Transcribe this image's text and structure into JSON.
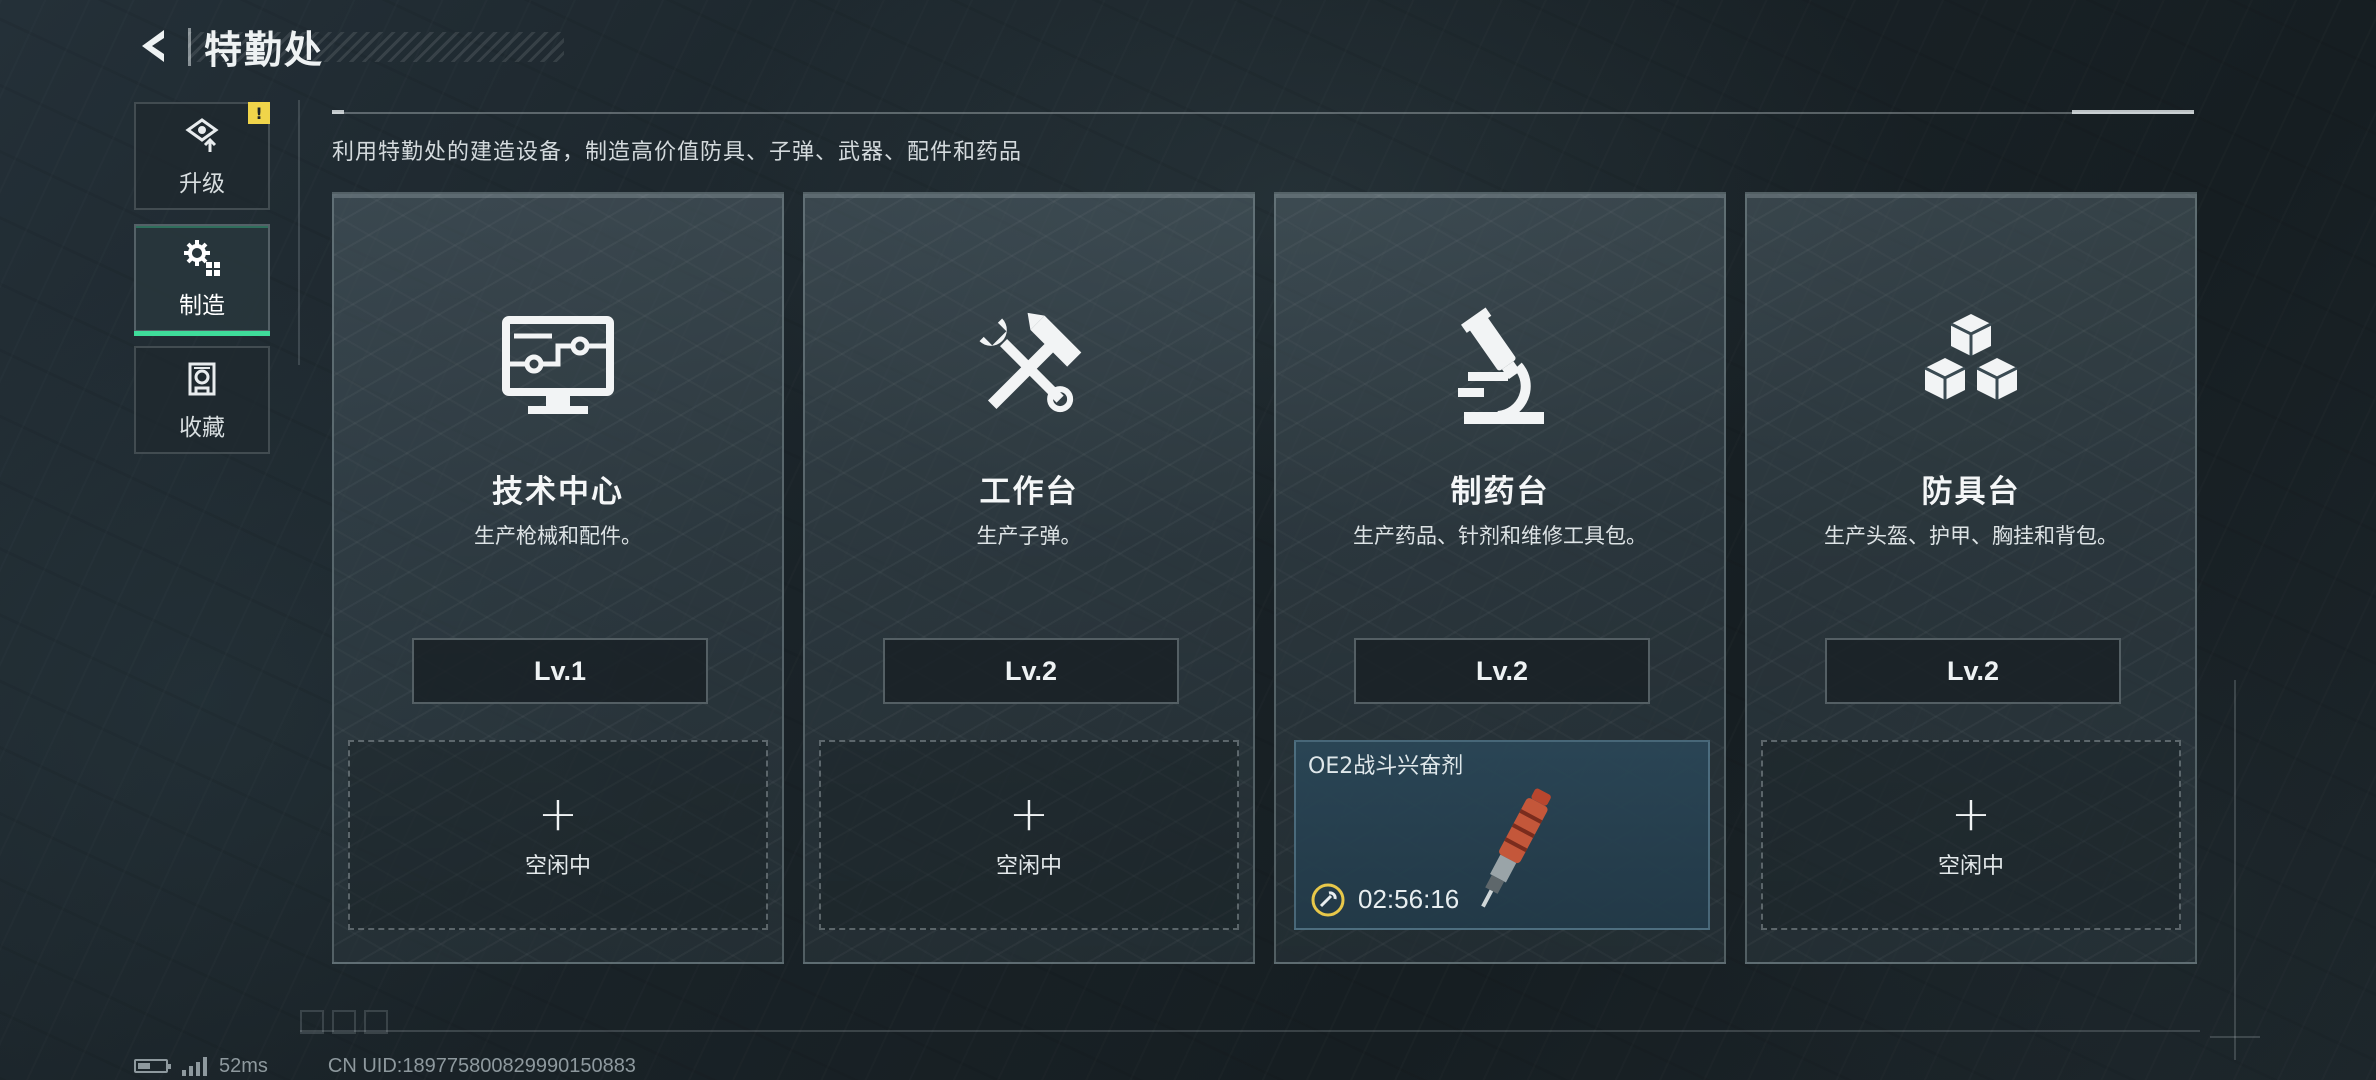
{
  "header": {
    "title": "特勤处"
  },
  "nav": {
    "items": [
      {
        "label": "升级",
        "icon": "upgrade-icon",
        "alert": "!"
      },
      {
        "label": "制造",
        "icon": "gear-grid-icon",
        "active": true
      },
      {
        "label": "收藏",
        "icon": "collection-icon"
      }
    ]
  },
  "description": "利用特勤处的建造设备，制造高价值防具、子弹、武器、配件和药品",
  "stations": [
    {
      "title": "技术中心",
      "subtitle": "生产枪械和配件。",
      "level": "Lv.1",
      "slot": {
        "status": "idle",
        "plus": "+",
        "label": "空闲中"
      },
      "icon": "computer-icon"
    },
    {
      "title": "工作台",
      "subtitle": "生产子弹。",
      "level": "Lv.2",
      "slot": {
        "status": "idle",
        "plus": "+",
        "label": "空闲中"
      },
      "icon": "hammer-wrench-icon"
    },
    {
      "title": "制药台",
      "subtitle": "生产药品、针剂和维修工具包。",
      "level": "Lv.2",
      "slot": {
        "status": "crafting",
        "item_name": "OE2战斗兴奋剂",
        "timer": "02:56:16"
      },
      "icon": "microscope-icon"
    },
    {
      "title": "防具台",
      "subtitle": "生产头盔、护甲、胸挂和背包。",
      "level": "Lv.2",
      "slot": {
        "status": "idle",
        "plus": "+",
        "label": "空闲中"
      },
      "icon": "boxes-icon"
    }
  ],
  "status_bar": {
    "latency": "52ms",
    "uid": "CN UID:1897758008299901508​83"
  },
  "colors": {
    "accent_green": "#3fdc9a",
    "alert_yellow": "#f0d44a",
    "crafting_bg": "#2a4656"
  }
}
